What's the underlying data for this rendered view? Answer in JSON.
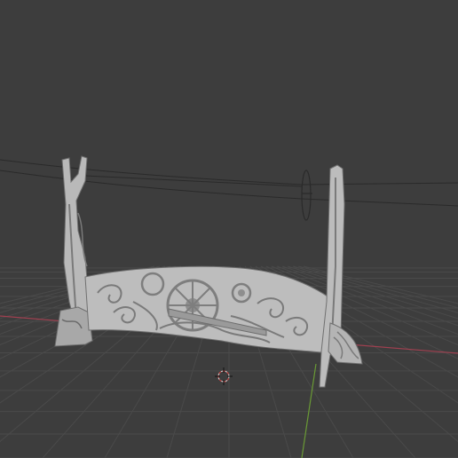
{
  "app": {
    "viewport": {
      "background": "#3d3d3d",
      "grid_color": "#4a4a4a",
      "x_axis_color": "#a04050",
      "y_axis_color": "#6a9a35"
    },
    "object": {
      "material_color": "#b9b9b9",
      "shade_color": "#8e8e8e",
      "wire_color": "#2a2a2a"
    },
    "icons": {
      "cursor": "3d-cursor-icon"
    }
  }
}
